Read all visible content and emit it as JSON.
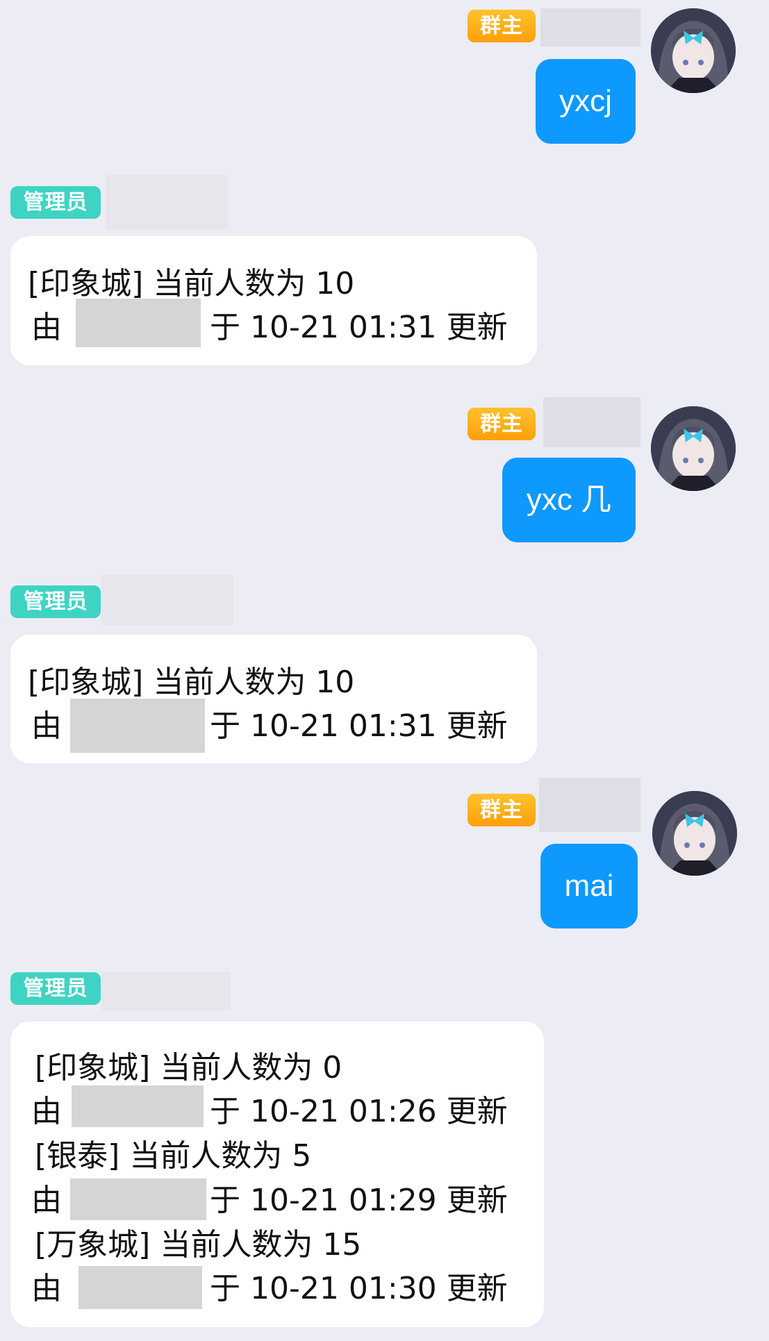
{
  "badges": {
    "owner": "群主",
    "admin": "管理员"
  },
  "messages": [
    {
      "side": "out",
      "text": "yxcj"
    },
    {
      "side": "in",
      "lines": [
        {
          "text": "[印象城] 当前人数为 10"
        },
        {
          "prefix": "由",
          "suffix": "于 10-21 01:31 更新"
        }
      ]
    },
    {
      "side": "out",
      "text": "yxc 几"
    },
    {
      "side": "in",
      "lines": [
        {
          "text": "[印象城] 当前人数为 10"
        },
        {
          "prefix": "由",
          "suffix": "于 10-21 01:31 更新"
        }
      ]
    },
    {
      "side": "out",
      "text": "mai"
    },
    {
      "side": "in",
      "lines": [
        {
          "text": "[印象城] 当前人数为 0"
        },
        {
          "prefix": "由",
          "suffix": "于 10-21 01:26 更新"
        },
        {
          "text": "[银泰] 当前人数为 5"
        },
        {
          "prefix": "由",
          "suffix": "于 10-21 01:29 更新"
        },
        {
          "text": "[万象城] 当前人数为 15"
        },
        {
          "prefix": "由",
          "suffix": "于 10-21 01:30 更新"
        }
      ]
    }
  ],
  "colors": {
    "background": "#ececf4",
    "outgoing_bubble": "#0d99ff",
    "owner_badge": "#ff9f0a",
    "admin_badge": "#3fd3c3"
  }
}
